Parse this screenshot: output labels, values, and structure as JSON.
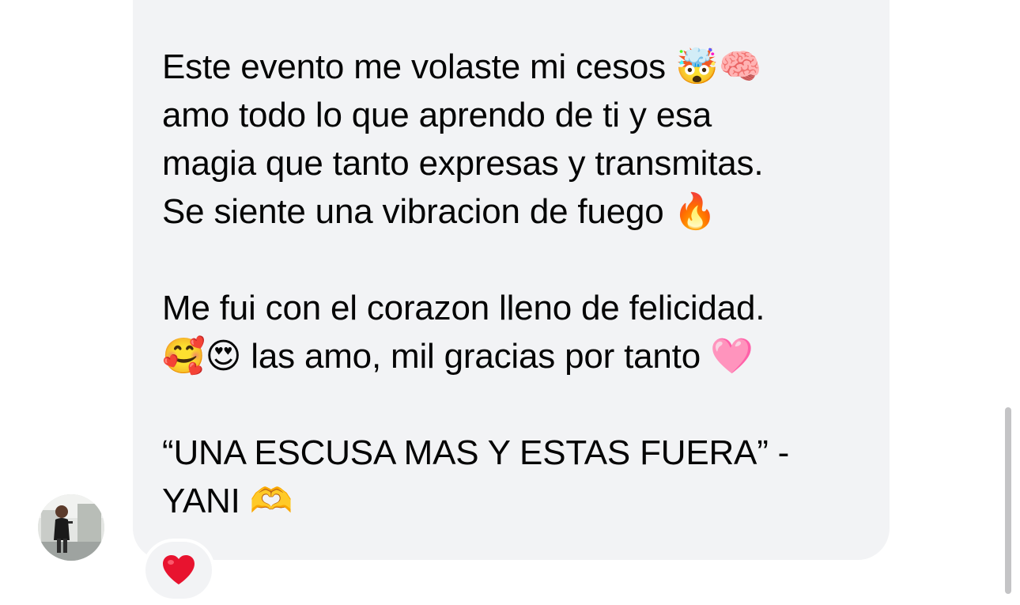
{
  "message": {
    "paragraphs": [
      "Este evento me volaste mi cesos 🤯🧠\namo todo lo que aprendo de ti y esa\nmagia que tanto expresas y transmitas.\nSe siente una vibracion de fuego 🔥",
      "Me fui con el corazon lleno de felicidad.\n🥰😍 las amo, mil gracias por tanto 🩷",
      "“UNA ESCUSA MAS Y ESTAS FUERA” -\nYANI 🫶"
    ]
  },
  "reaction": {
    "icon": "heart-icon",
    "color": "#e8132f"
  },
  "colors": {
    "bubble": "#f2f3f5",
    "text": "#050505",
    "scrollbar": "#c4c4c6"
  }
}
